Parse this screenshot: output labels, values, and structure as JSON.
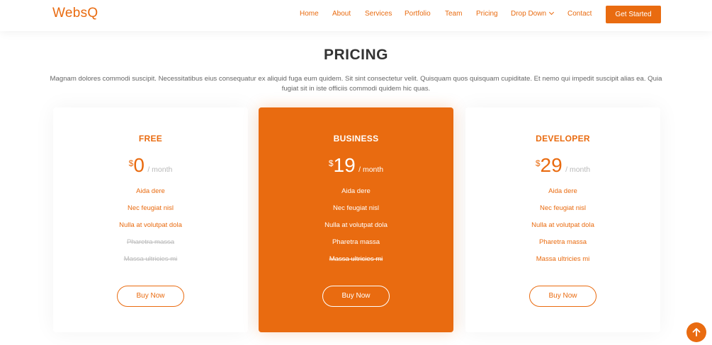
{
  "brand": {
    "name": "WebsQ",
    "accent": "#e96b10"
  },
  "nav": {
    "items": [
      "Home",
      "About",
      "Services",
      "Portfolio",
      "Team",
      "Pricing",
      "Drop Down",
      "Contact"
    ],
    "cta_label": "Get Started",
    "dropdown_icon": "chevron-down-icon"
  },
  "section": {
    "title": "PRICING",
    "description": "Magnam dolores commodi suscipit. Necessitatibus eius consequatur ex aliquid fuga eum quidem. Sit sint consectetur velit. Quisquam quos quisquam cupiditate. Et nemo qui impedit suscipit alias ea. Quia fugiat sit in iste officiis commodi quidem hic quas."
  },
  "plans": [
    {
      "name": "FREE",
      "currency": "$",
      "price": "0",
      "period": "/ month",
      "features": [
        {
          "text": "Aida dere",
          "available": true
        },
        {
          "text": "Nec feugiat nisl",
          "available": true
        },
        {
          "text": "Nulla at volutpat dola",
          "available": true
        },
        {
          "text": "Pharetra massa",
          "available": false
        },
        {
          "text": "Massa ultricies mi",
          "available": false
        }
      ],
      "button_label": "Buy Now",
      "featured": false
    },
    {
      "name": "BUSINESS",
      "currency": "$",
      "price": "19",
      "period": "/ month",
      "features": [
        {
          "text": "Aida dere",
          "available": true
        },
        {
          "text": "Nec feugiat nisl",
          "available": true
        },
        {
          "text": "Nulla at volutpat dola",
          "available": true
        },
        {
          "text": "Pharetra massa",
          "available": true
        },
        {
          "text": "Massa ultricies mi",
          "available": false
        }
      ],
      "button_label": "Buy Now",
      "featured": true
    },
    {
      "name": "DEVELOPER",
      "currency": "$",
      "price": "29",
      "period": "/ month",
      "features": [
        {
          "text": "Aida dere",
          "available": true
        },
        {
          "text": "Nec feugiat nisl",
          "available": true
        },
        {
          "text": "Nulla at volutpat dola",
          "available": true
        },
        {
          "text": "Pharetra massa",
          "available": true
        },
        {
          "text": "Massa ultricies mi",
          "available": true
        }
      ],
      "button_label": "Buy Now",
      "featured": false
    }
  ],
  "back_to_top_icon": "arrow-up-icon"
}
